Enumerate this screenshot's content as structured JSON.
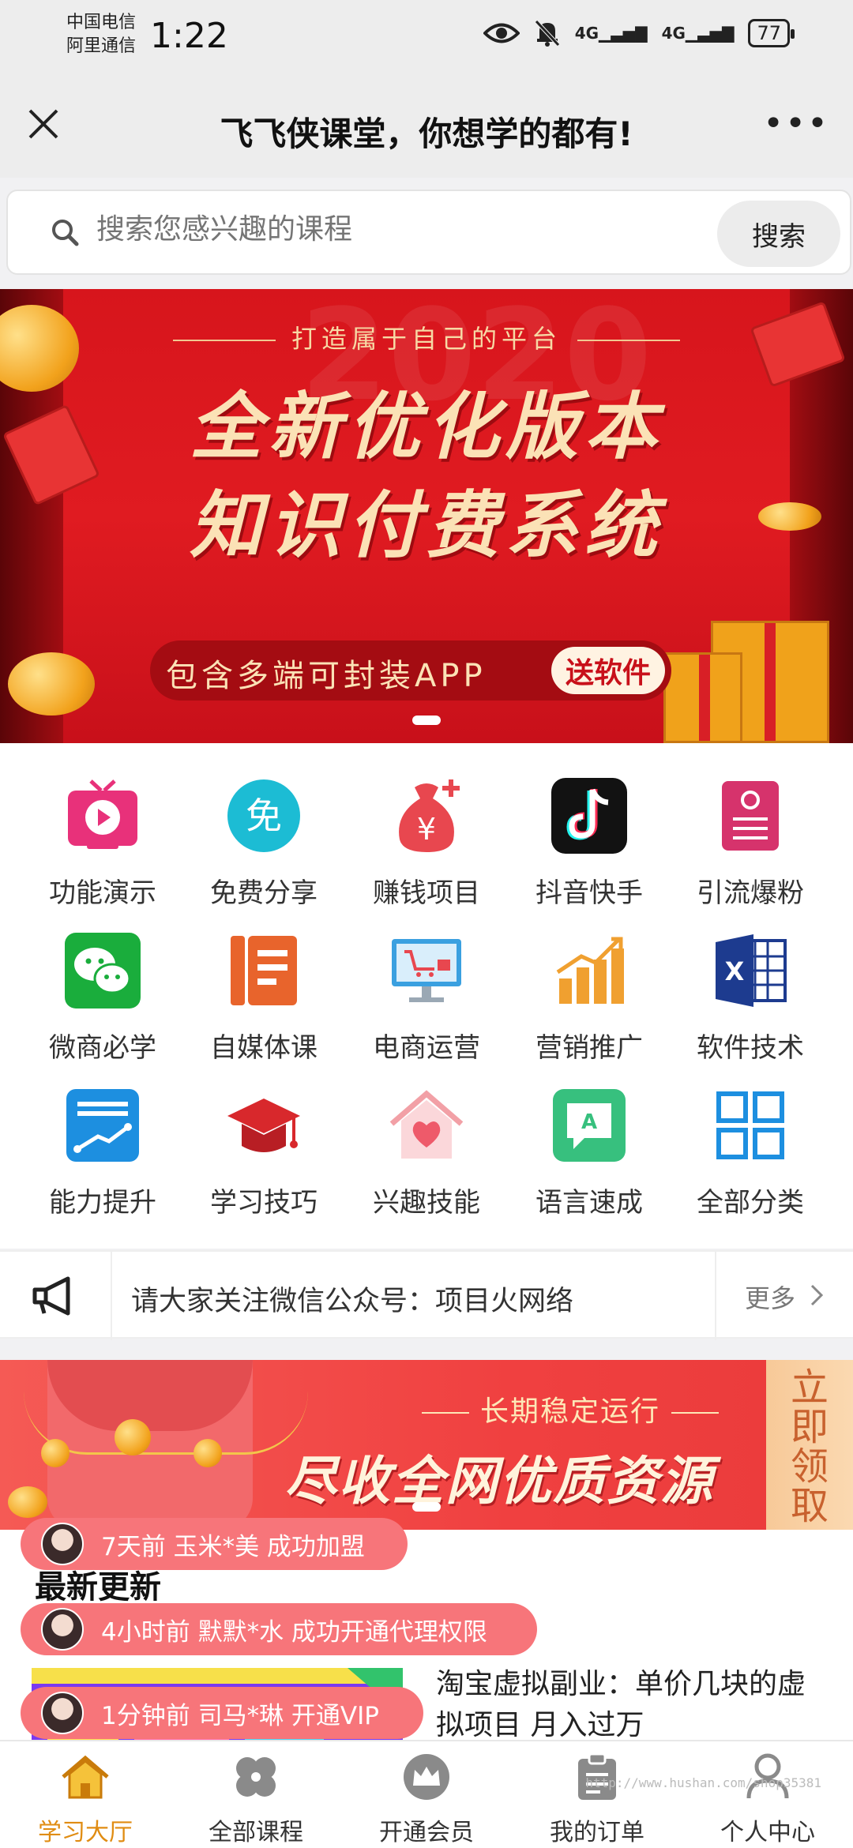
{
  "status_bar": {
    "carrier_1": "中国电信",
    "carrier_2": "阿里通信",
    "time": "1:22",
    "signal_1": "4G",
    "signal_2": "4G",
    "battery": "77"
  },
  "title_bar": {
    "title": "飞飞侠课堂，你想学的都有!",
    "more": "•••"
  },
  "search": {
    "placeholder": "搜索您感兴趣的课程",
    "button": "搜索"
  },
  "banner": {
    "year": "2020",
    "tag": "打造属于自己的平台",
    "headline_1": "全新优化版本",
    "headline_2": "知识付费系统",
    "pill_text": "包含多端可封装APP",
    "pill_badge": "送软件"
  },
  "categories": [
    {
      "label": "功能演示",
      "icon": "tv-play-icon"
    },
    {
      "label": "免费分享",
      "icon": "free-icon"
    },
    {
      "label": "赚钱项目",
      "icon": "money-bag-icon"
    },
    {
      "label": "抖音快手",
      "icon": "tiktok-icon"
    },
    {
      "label": "引流爆粉",
      "icon": "refresh-list-icon"
    },
    {
      "label": "微商必学",
      "icon": "wechat-icon"
    },
    {
      "label": "自媒体课",
      "icon": "document-icon"
    },
    {
      "label": "电商运营",
      "icon": "monitor-cart-icon"
    },
    {
      "label": "营销推广",
      "icon": "bar-chart-icon"
    },
    {
      "label": "软件技术",
      "icon": "excel-icon"
    },
    {
      "label": "能力提升",
      "icon": "growth-chart-icon"
    },
    {
      "label": "学习技巧",
      "icon": "graduation-cap-icon"
    },
    {
      "label": "兴趣技能",
      "icon": "heart-house-icon"
    },
    {
      "label": "语言速成",
      "icon": "speech-bubble-icon"
    },
    {
      "label": "全部分类",
      "icon": "grid-icon"
    }
  ],
  "notice": {
    "text": "请大家关注微信公众号：项目火网络",
    "more": "更多"
  },
  "promo": {
    "tag": "长期稳定运行",
    "headline": "尽收全网优质资源",
    "side": "立即领取"
  },
  "latest": {
    "title": "最新更新",
    "course_title": "淘宝虚拟副业：单价几块的虚拟项目 月入过万"
  },
  "toasts": [
    "7天前 玉米*美 成功加盟",
    "4小时前 默默*水 成功开通代理权限",
    "1分钟前 司马*琳 开通VIP"
  ],
  "tabs": [
    {
      "label": "学习大厅",
      "icon": "home-icon"
    },
    {
      "label": "全部课程",
      "icon": "clover-icon"
    },
    {
      "label": "开通会员",
      "icon": "crown-icon"
    },
    {
      "label": "我的订单",
      "icon": "clipboard-icon"
    },
    {
      "label": "个人中心",
      "icon": "user-icon"
    }
  ],
  "footer_watermark": "http://www.hushan.com/shop35381",
  "colors": {
    "banner_red": "#d7151c",
    "accent_orange": "#e08c12",
    "toast_pink": "#f7757a"
  }
}
